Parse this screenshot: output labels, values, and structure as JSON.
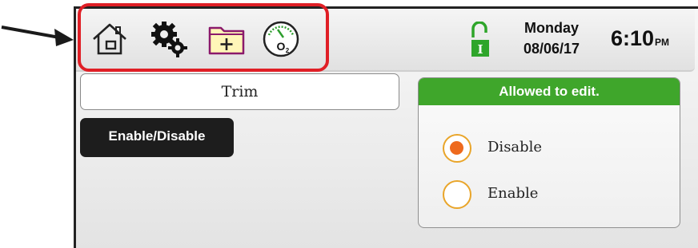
{
  "toolbar": {
    "icons": [
      "home-icon",
      "settings-gears-icon",
      "new-folder-icon",
      "o2-gauge-icon"
    ],
    "o2_label": "O2"
  },
  "status": {
    "lock_letter": "I",
    "day": "Monday",
    "date": "08/06/17",
    "time": "6:10",
    "ampm": "PM"
  },
  "main": {
    "field_value": "Trim",
    "toggle_button_label": "Enable/Disable"
  },
  "edit_panel": {
    "title": "Allowed to edit.",
    "options": [
      {
        "label": "Disable",
        "selected": true
      },
      {
        "label": "Enable",
        "selected": false
      }
    ]
  },
  "colors": {
    "highlight": "#e01f26",
    "panel_header": "#3fa62b",
    "radio_selected": "#ee6a1e",
    "radio_ring": "#e9a52a"
  }
}
